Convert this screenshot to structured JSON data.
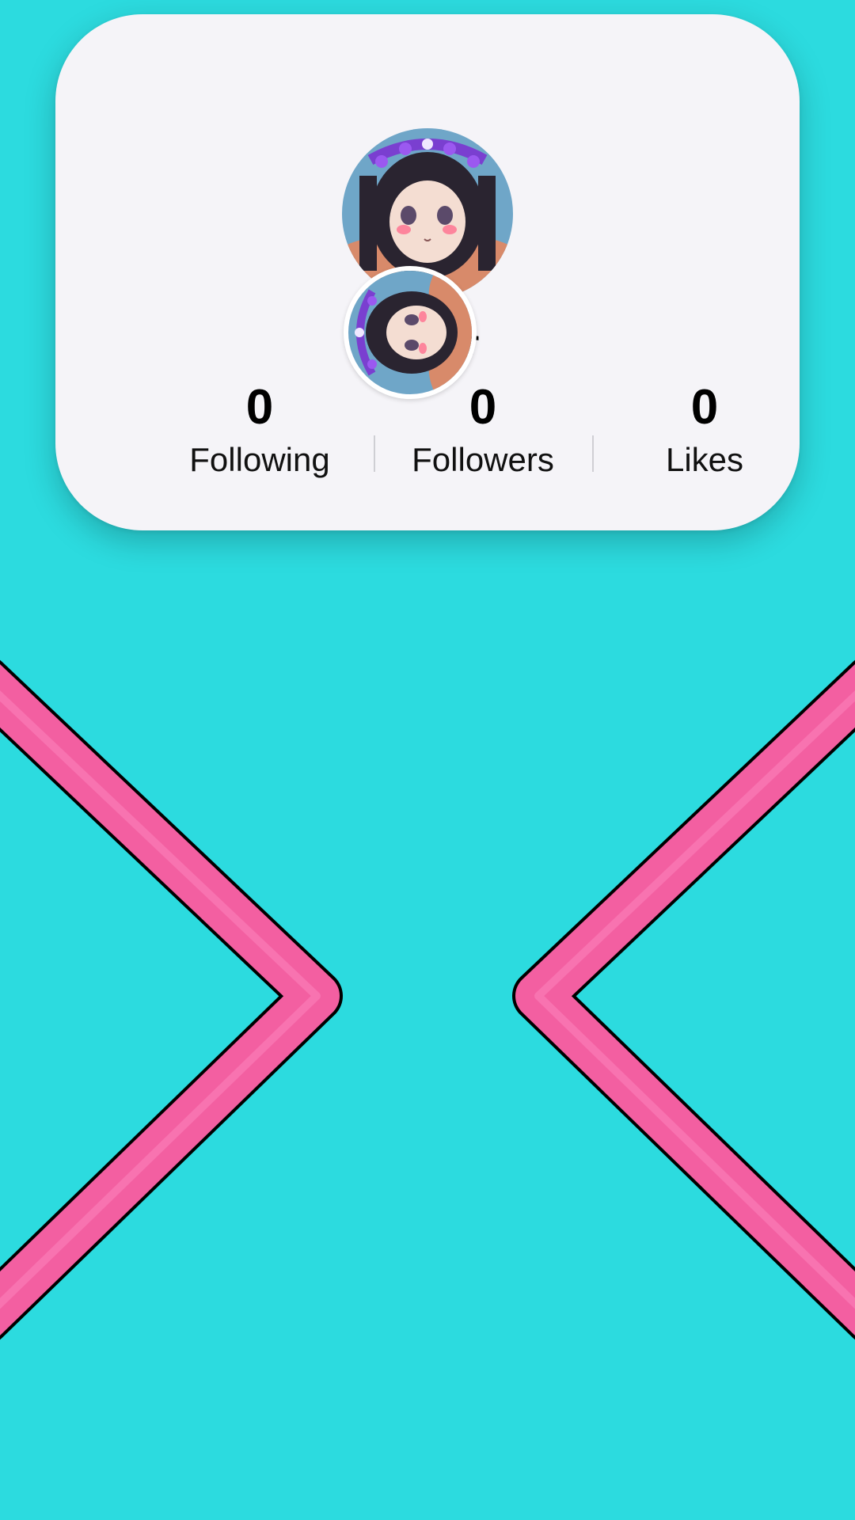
{
  "profile": {
    "name_fragment": "r",
    "avatar_description": "anime-avatar-image"
  },
  "stats": [
    {
      "value": "0",
      "label": "Following"
    },
    {
      "value": "0",
      "label": "Followers"
    },
    {
      "value": "0",
      "label": "Likes"
    }
  ],
  "colors": {
    "background": "#2cdbdf",
    "card": "#f5f4f8",
    "chevron": "#f35fa1",
    "chevron_outline": "#000000"
  },
  "icons": {
    "left": "chevron-right-icon",
    "right": "chevron-left-icon"
  }
}
